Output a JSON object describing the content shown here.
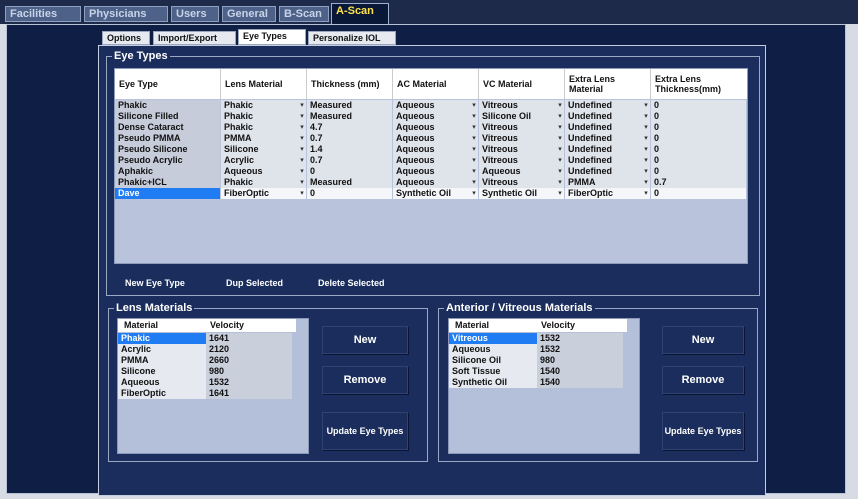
{
  "top_tabs": [
    "Facilities",
    "Physicians",
    "Users",
    "General",
    "B-Scan",
    "A-Scan"
  ],
  "sub_tabs": [
    "Options",
    "Import/Export",
    "Eye Types",
    "Personalize IOL"
  ],
  "eye_types": {
    "title": "Eye Types",
    "headers": [
      "Eye Type",
      "Lens Material",
      "Thickness (mm)",
      "AC Material",
      "VC Material",
      "Extra Lens Material",
      "Extra Lens Thickness(mm)"
    ],
    "rows": [
      [
        "Phakic",
        "Phakic",
        "Measured",
        "Aqueous",
        "Vitreous",
        "Undefined",
        "0"
      ],
      [
        "Silicone Filled",
        "Phakic",
        "Measured",
        "Aqueous",
        "Silicone Oil",
        "Undefined",
        "0"
      ],
      [
        "Dense Cataract",
        "Phakic",
        "4.7",
        "Aqueous",
        "Vitreous",
        "Undefined",
        "0"
      ],
      [
        "Pseudo PMMA",
        "PMMA",
        "0.7",
        "Aqueous",
        "Vitreous",
        "Undefined",
        "0"
      ],
      [
        "Pseudo Silicone",
        "Silicone",
        "1.4",
        "Aqueous",
        "Vitreous",
        "Undefined",
        "0"
      ],
      [
        "Pseudo Acrylic",
        "Acrylic",
        "0.7",
        "Aqueous",
        "Vitreous",
        "Undefined",
        "0"
      ],
      [
        "Aphakic",
        "Aqueous",
        "0",
        "Aqueous",
        "Aqueous",
        "Undefined",
        "0"
      ],
      [
        "Phakic+ICL",
        "Phakic",
        "Measured",
        "Aqueous",
        "Vitreous",
        "PMMA",
        "0.7"
      ],
      [
        "Dave",
        "FiberOptic",
        "0",
        "Synthetic Oil",
        "Synthetic Oil",
        "FiberOptic",
        "0"
      ]
    ],
    "buttons": [
      "New Eye Type",
      "Dup Selected",
      "Delete Selected"
    ]
  },
  "lens_materials": {
    "title": "Lens Materials",
    "headers": [
      "Material",
      "Velocity"
    ],
    "rows": [
      [
        "Phakic",
        "1641"
      ],
      [
        "Acrylic",
        "2120"
      ],
      [
        "PMMA",
        "2660"
      ],
      [
        "Silicone",
        "980"
      ],
      [
        "Aqueous",
        "1532"
      ],
      [
        "FiberOptic",
        "1641"
      ]
    ],
    "buttons": [
      "New",
      "Remove",
      "Update Eye Types"
    ]
  },
  "av_materials": {
    "title": "Anterior / Vitreous Materials",
    "headers": [
      "Material",
      "Velocity"
    ],
    "rows": [
      [
        "Vitreous",
        "1532"
      ],
      [
        "Aqueous",
        "1532"
      ],
      [
        "Silicone Oil",
        "980"
      ],
      [
        "Soft Tissue",
        "1540"
      ],
      [
        "Synthetic Oil",
        "1540"
      ]
    ],
    "buttons": [
      "New",
      "Remove",
      "Update Eye Types"
    ]
  },
  "colors": {
    "panel": "#1a2d5c",
    "selected": "#1f7cf2",
    "active_tab_text": "#ffe24a"
  }
}
